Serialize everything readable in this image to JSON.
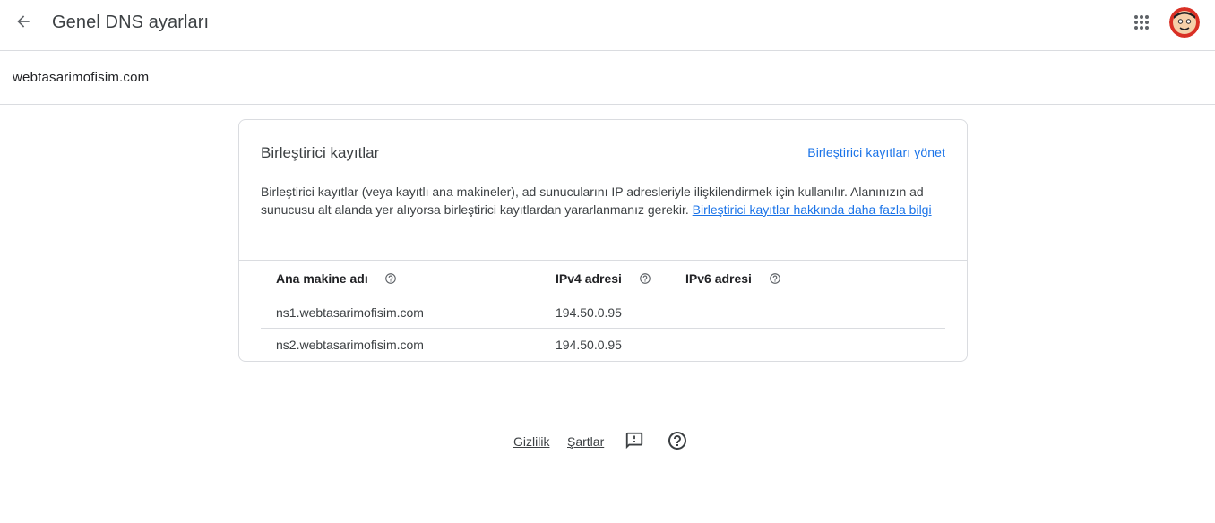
{
  "header": {
    "title": "Genel DNS ayarları",
    "back_icon": "arrow-back-icon",
    "apps_icon": "apps-grid-icon",
    "avatar_icon": "user-avatar-icon"
  },
  "domain": "webtasarimofisim.com",
  "card": {
    "title": "Birleştirici kayıtlar",
    "manage_link": "Birleştirici kayıtları yönet",
    "description": "Birleştirici kayıtlar (veya kayıtlı ana makineler), ad sunucularını IP adresleriyle ilişkilendirmek için kullanılır. Alanınızın ad sunucusu alt alanda yer alıyorsa birleştirici kayıtlardan yararlanmanız gerekir.",
    "learn_more": "Birleştirici kayıtlar hakkında daha fazla bilgi",
    "table": {
      "columns": [
        "Ana makine adı",
        "IPv4 adresi",
        "IPv6 adresi"
      ],
      "rows": [
        {
          "host": "ns1.webtasarimofisim.com",
          "ipv4": "194.50.0.95",
          "ipv6": ""
        },
        {
          "host": "ns2.webtasarimofisim.com",
          "ipv4": "194.50.0.95",
          "ipv6": ""
        }
      ]
    }
  },
  "footer": {
    "privacy": "Gizlilik",
    "terms": "Şartlar",
    "feedback_icon": "feedback-icon",
    "help_icon": "help-icon"
  },
  "colors": {
    "link": "#1a73e8",
    "divider": "#dadce0",
    "text": "#3c4043"
  }
}
